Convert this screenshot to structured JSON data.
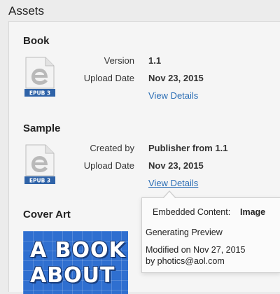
{
  "header": {
    "title": "Assets"
  },
  "book": {
    "title": "Book",
    "icon_label": "EPUB 3",
    "version_label": "Version",
    "version_value": "1.1",
    "upload_label": "Upload Date",
    "upload_value": "Nov 23, 2015",
    "details_link": "View Details"
  },
  "sample": {
    "title": "Sample",
    "icon_label": "EPUB 3",
    "created_label": "Created by",
    "created_value": "Publisher from 1.1",
    "upload_label": "Upload Date",
    "upload_value": "Nov 23, 2015",
    "details_link": "View Details"
  },
  "cover_art": {
    "title": "Cover Art",
    "line1": "A BOOK",
    "line2": "ABOUT"
  },
  "popover": {
    "embedded_label": "Embedded Content:",
    "embedded_value": "Image",
    "status": "Generating Preview",
    "modified": "Modified on Nov 27, 2015",
    "by": "by photics@aol.com"
  },
  "colors": {
    "link": "#2a6db5",
    "cover_bg": "#2f6fd0",
    "epub_badge": "#2f63a8"
  },
  "icons": [
    "epub-file-icon"
  ]
}
